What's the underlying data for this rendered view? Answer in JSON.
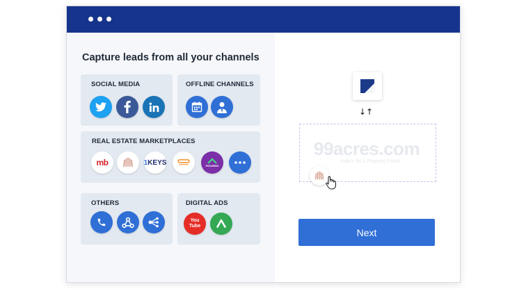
{
  "window": {
    "controls": [
      "dot",
      "dot",
      "dot"
    ]
  },
  "left": {
    "heading": "Capture leads from all your channels",
    "cards": {
      "social": {
        "title": "SOCIAL MEDIA",
        "icons": [
          "twitter-icon",
          "facebook-icon",
          "linkedin-icon"
        ]
      },
      "offline": {
        "title": "OFFLINE CHANNELS",
        "icons": [
          "calendar-icon",
          "user-icon"
        ]
      },
      "marketplaces": {
        "title": "REAL ESTATE MARKETPLACES",
        "icons": [
          "magicbricks-icon",
          "99acres-icon",
          "1keys-icon",
          "commonfloor-icon",
          "housing-icon",
          "more-icon"
        ],
        "labels": {
          "mb": "mb",
          "keys_num": "1",
          "keys": "KEYS",
          "housing": "HOUSING"
        }
      },
      "others": {
        "title": "OTHERS",
        "icons": [
          "phone-icon",
          "webhook-icon",
          "integration-icon"
        ]
      },
      "ads": {
        "title": "DIGITAL ADS",
        "icons": [
          "youtube-icon",
          "google-ads-icon"
        ],
        "labels": {
          "youtube": "You Tube"
        }
      }
    }
  },
  "right": {
    "arrows": "↓↑",
    "watermark": {
      "title": "99acres.com",
      "subtitle": "India's No.1 Property Portal"
    },
    "next_label": "Next"
  },
  "colors": {
    "titlebar": "#17348c",
    "accent": "#2f6fd6",
    "card_bg": "#e2e9f0",
    "left_bg": "#f5f7fa"
  }
}
